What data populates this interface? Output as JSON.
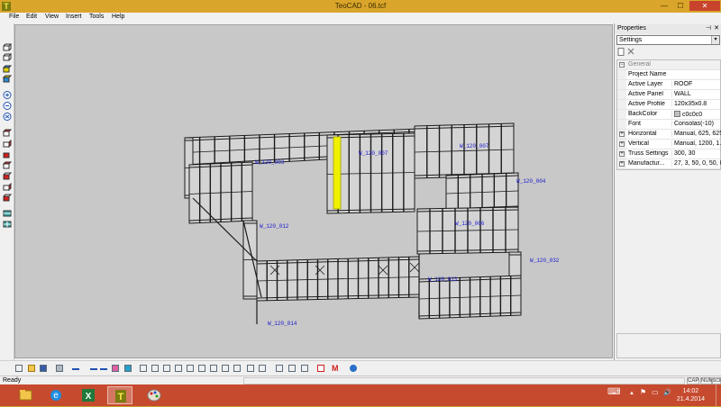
{
  "window": {
    "title": "TeoCAD - 06.tcf",
    "app_icon": "T",
    "controls": {
      "minimize": "—",
      "maximize": "☐",
      "close": "✕"
    }
  },
  "menu": [
    "File",
    "Edit",
    "View",
    "Insert",
    "Tools",
    "Help"
  ],
  "left_toolbar": {
    "icons": [
      "view-cube-icon",
      "view-cube-icon",
      "view-cube-colored-icon",
      "view-cube-colored-icon",
      "zoom-in-icon",
      "zoom-out-icon",
      "zoom-extents-icon",
      "red-cube-icon",
      "red-cube-icon",
      "red-cube-icon",
      "red-cube-icon",
      "red-cube-icon",
      "red-cube-icon",
      "red-cube-icon",
      "layer-cube-icon",
      "layer-cube-icon"
    ]
  },
  "canvas": {
    "background": "#c8c8c8",
    "wall_color": "#1a1a1a",
    "label_color": "#1a1ad0",
    "highlight_color": "#f0f000",
    "labels": [
      "W_120_003",
      "W_120_007",
      "W_120_004",
      "W_120_012",
      "W_120_006",
      "W_120_032",
      "W_120_013",
      "W_120_014"
    ]
  },
  "properties": {
    "header": "Properties",
    "pin": "⊣",
    "close": "✕",
    "selected": "Settings",
    "dropdown_arrow": "▾",
    "category": "General",
    "rows": [
      {
        "key": "Project Name",
        "value": "",
        "expandable": false
      },
      {
        "key": "Active Layer",
        "value": "ROOF",
        "expandable": false
      },
      {
        "key": "Active Panel",
        "value": "WALL",
        "expandable": false
      },
      {
        "key": "Active Profile",
        "value": "120x35x0.8",
        "expandable": false
      },
      {
        "key": "BackColor",
        "value": "c0c0c0",
        "expandable": false,
        "swatch": "#c0c0c0"
      },
      {
        "key": "Font",
        "value": "Consolas(-10)",
        "expandable": false
      },
      {
        "key": "Horizontal",
        "value": "Manual, 625, 625",
        "expandable": true
      },
      {
        "key": "Vertical",
        "value": "Manual, 1200, 1...",
        "expandable": true
      },
      {
        "key": "Truss Settings",
        "value": "300, 30",
        "expandable": true
      },
      {
        "key": "Manufactur...",
        "value": "27, 3, 50, 0, 50, 0",
        "expandable": true
      }
    ]
  },
  "bottom_toolbar": {
    "icons": [
      "new-icon",
      "open-icon",
      "save-icon",
      "print-icon",
      "undo-icon",
      "point-icon",
      "line-icon",
      "erase-icon",
      "fill-icon",
      "frame-icon",
      "frame-icon",
      "frame-icon",
      "frame-icon",
      "frame-icon",
      "frame-icon",
      "frame-icon",
      "frame-icon",
      "frame-icon",
      "measure-icon",
      "measure-icon",
      "move-icon",
      "copy-icon",
      "mirror-icon",
      "truss-icon",
      "m-icon",
      "help-icon"
    ],
    "m_label": "M"
  },
  "status": {
    "text": "Ready",
    "indicators": [
      "CAP",
      "NUM",
      "SCRL"
    ]
  },
  "taskbar": {
    "apps": [
      "file-explorer-icon",
      "internet-explorer-icon",
      "excel-icon",
      "teocad-icon",
      "paint-icon"
    ],
    "excel_glyph": "X",
    "ie_glyph": "e",
    "teocad_glyph": "T",
    "tray": {
      "keyboard": "⌨",
      "arrow": "▲",
      "flag": "⚑",
      "monitor": "▭",
      "volume": "🔊"
    },
    "time": "14:02",
    "date": "21.4.2014"
  }
}
